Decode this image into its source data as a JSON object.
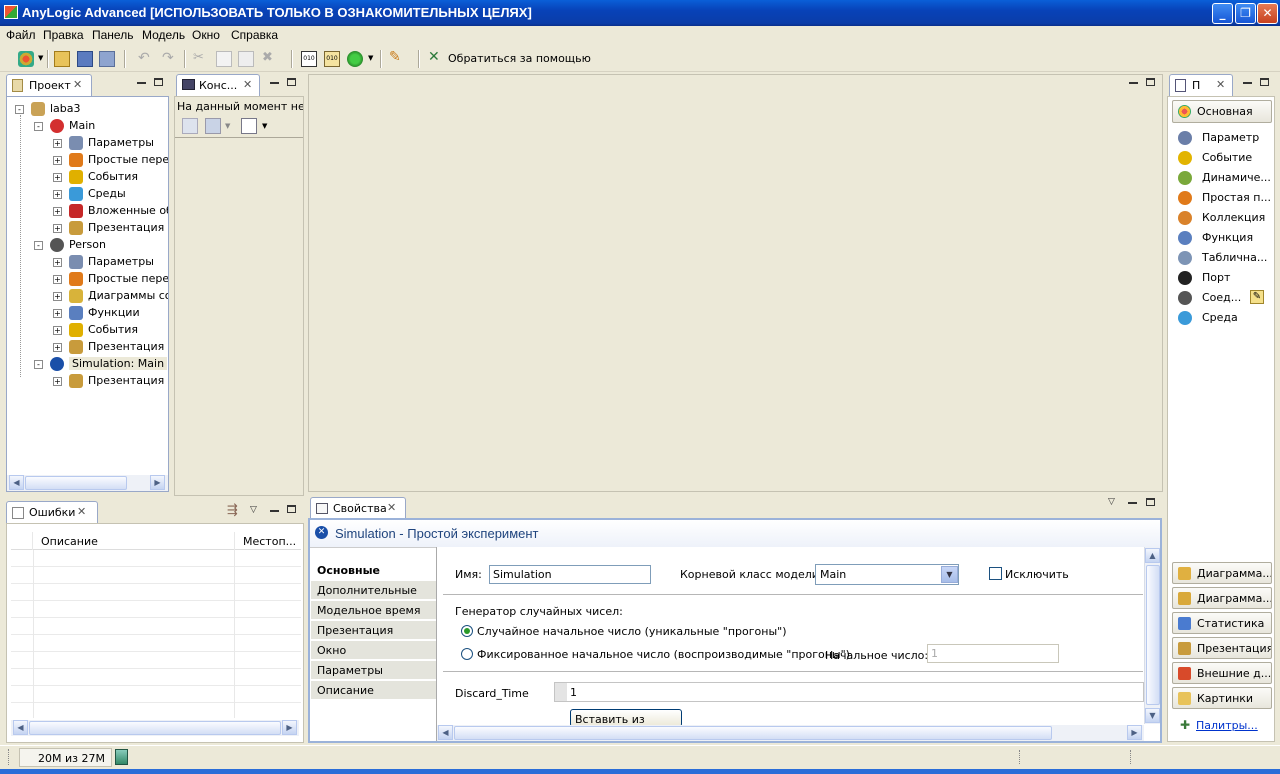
{
  "window": {
    "title": "AnyLogic Advanced [ИСПОЛЬЗОВАТЬ ТОЛЬКО В ОЗНАКОМИТЕЛЬНЫХ ЦЕЛЯХ]"
  },
  "menu": [
    "Файл",
    "Правка",
    "Панель",
    "Модель",
    "Окно",
    "Справка"
  ],
  "toolbar": {
    "help_label": "Обратиться за помощью"
  },
  "project_view": {
    "tab": "Проект",
    "tree": [
      {
        "label": "laba3",
        "level": 0,
        "exp": "-",
        "icon": "project-icon"
      },
      {
        "label": "Main",
        "level": 1,
        "exp": "-",
        "icon": "active-class-icon"
      },
      {
        "label": "Параметры",
        "level": 2,
        "exp": "+",
        "icon": "parameters-icon"
      },
      {
        "label": "Простые перем",
        "level": 2,
        "exp": "+",
        "icon": "variables-icon"
      },
      {
        "label": "События",
        "level": 2,
        "exp": "+",
        "icon": "events-icon"
      },
      {
        "label": "Среды",
        "level": 2,
        "exp": "+",
        "icon": "environment-icon"
      },
      {
        "label": "Вложенные объ",
        "level": 2,
        "exp": "+",
        "icon": "embedded-objects-icon"
      },
      {
        "label": "Презентация",
        "level": 2,
        "exp": "+",
        "icon": "presentation-icon"
      },
      {
        "label": "Person",
        "level": 1,
        "exp": "-",
        "icon": "agent-class-icon"
      },
      {
        "label": "Параметры",
        "level": 2,
        "exp": "+",
        "icon": "parameters-icon"
      },
      {
        "label": "Простые перем",
        "level": 2,
        "exp": "+",
        "icon": "variables-icon"
      },
      {
        "label": "Диаграммы сос",
        "level": 2,
        "exp": "+",
        "icon": "statecharts-icon"
      },
      {
        "label": "Функции",
        "level": 2,
        "exp": "+",
        "icon": "functions-icon"
      },
      {
        "label": "События",
        "level": 2,
        "exp": "+",
        "icon": "events-icon"
      },
      {
        "label": "Презентация",
        "level": 2,
        "exp": "+",
        "icon": "presentation-icon"
      },
      {
        "label": "Simulation: Main",
        "level": 1,
        "exp": "-",
        "icon": "experiment-icon"
      },
      {
        "label": "Презентация",
        "level": 2,
        "exp": "+",
        "icon": "presentation-icon"
      }
    ]
  },
  "console_view": {
    "tab": "Конс...",
    "message": "На данный момент нет к"
  },
  "errors_view": {
    "tab": "Ошибки",
    "columns": [
      "Описание",
      "Местоп..."
    ]
  },
  "properties_view": {
    "tab": "Свойства",
    "header": "Simulation - Простой эксперимент",
    "sections": [
      "Основные",
      "Дополнительные",
      "Модельное время",
      "Презентация",
      "Окно",
      "Параметры",
      "Описание"
    ],
    "name_label": "Имя:",
    "name_value": "Simulation",
    "root_class_label": "Корневой класс модели:",
    "root_class_value": "Main",
    "exclude_label": "Исключить",
    "rng_label": "Генератор случайных чисел:",
    "random_seed_label": "Случайное начальное число (уникальные \"прогоны\")",
    "fixed_seed_label": "Фиксированное начальное число (воспроизводимые \"прогоны\")",
    "seed_label": "Начальное число:",
    "seed_value": "1",
    "param_name": "Discard_Time",
    "param_value": "1",
    "paste_button": "Вставить из буфера"
  },
  "palette_view": {
    "tab": "П",
    "top_button": "Основная",
    "items": [
      {
        "label": "Параметр",
        "icon": "parameter-icon",
        "color": "#6a7ea8"
      },
      {
        "label": "Событие",
        "icon": "event-icon",
        "color": "#e2b400"
      },
      {
        "label": "Динамиче...",
        "icon": "dynamic-variable-icon",
        "color": "#7aa83a"
      },
      {
        "label": "Простая п...",
        "icon": "simple-variable-icon",
        "color": "#e07a1a"
      },
      {
        "label": "Коллекция",
        "icon": "collection-icon",
        "color": "#d9822b"
      },
      {
        "label": "Функция",
        "icon": "function-icon",
        "color": "#5a7fbf"
      },
      {
        "label": "Таблична...",
        "icon": "table-function-icon",
        "color": "#7d94b5"
      },
      {
        "label": "Порт",
        "icon": "port-icon",
        "color": "#222222"
      },
      {
        "label": "Соед...",
        "icon": "connector-icon",
        "color": "#555555"
      },
      {
        "label": "Среда",
        "icon": "environment-icon",
        "color": "#3a9ad9"
      }
    ],
    "bottom_buttons": [
      "Диаграмма...",
      "Диаграмма...",
      "Статистика",
      "Презентация",
      "Внешние д...",
      "Картинки"
    ],
    "palettes_link": "Палитры..."
  },
  "status": {
    "memory": "20M из 27M"
  }
}
